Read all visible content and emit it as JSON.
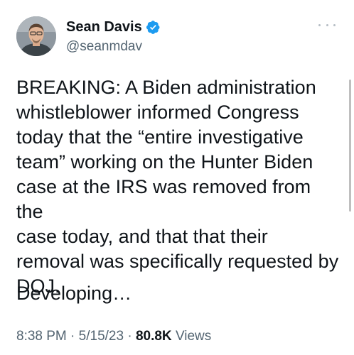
{
  "tweet": {
    "author": {
      "display_name": "Sean Davis",
      "handle": "@seanmdav",
      "verified": true
    },
    "text": "BREAKING: A Biden administration\nwhistleblower informed Congress\ntoday that the “entire investigative\nteam” working on the Hunter Biden\ncase at the IRS was removed from the\ncase today, and that that their\nremoval was specifically requested by\nDOJ.",
    "text_2": "Developing…",
    "time": "8:38 PM",
    "separator": "·",
    "date": "5/15/23",
    "views_count": "80.8K",
    "views_label": "Views"
  },
  "colors": {
    "verified_badge": "#1d9bf0",
    "primary_text": "#0f1419",
    "secondary_text": "#536471"
  },
  "icons": {
    "verified": "verified-badge-icon",
    "more": "more-options-icon"
  }
}
